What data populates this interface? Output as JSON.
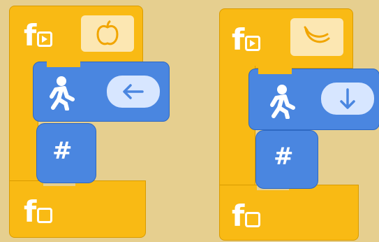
{
  "programs": [
    {
      "fruit_icon": "apple-icon",
      "direction_icon": "arrow-left-icon",
      "move_icon": "walking-person-icon",
      "repeat_icon": "grid-hash-icon",
      "function_def_label": "f",
      "function_call_label": "f"
    },
    {
      "fruit_icon": "banana-icon",
      "direction_icon": "arrow-down-icon",
      "move_icon": "walking-person-icon",
      "repeat_icon": "grid-hash-icon",
      "function_def_label": "f",
      "function_call_label": "f"
    }
  ],
  "colors": {
    "background": "#E6CF8F",
    "function_block": "#F9BA14",
    "action_block": "#4A86E0",
    "slot": "#FCE7B2",
    "pill": "#D7E6FF"
  }
}
